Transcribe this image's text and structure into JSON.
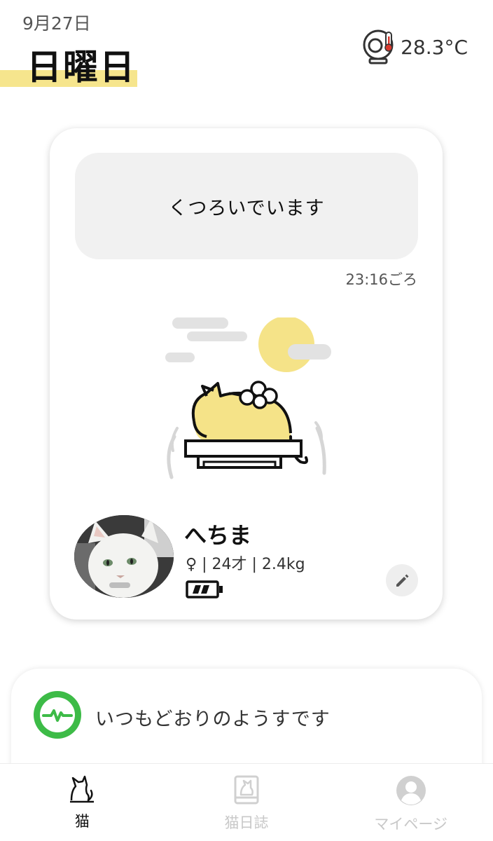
{
  "header": {
    "date": "9月27日",
    "weekday": "日曜日",
    "temperature": "28.3°C",
    "temperature_icon": "room-thermometer-icon"
  },
  "status_card": {
    "status_message": "くつろいでいます",
    "time": "23:16ごろ",
    "illustration_icon": "cat-sleeping-on-bed-icon"
  },
  "cat": {
    "name": "へちま",
    "info": "♀ | 24才 | 2.4kg",
    "battery_icon": "battery-icon",
    "edit_icon": "pencil-icon"
  },
  "health": {
    "message": "いつもどおりのようすです",
    "icon": "heartbeat-icon",
    "accent": "#3dbb47"
  },
  "bottom_nav": {
    "items": [
      {
        "label": "猫",
        "icon": "cat-icon"
      },
      {
        "label": "猫日誌",
        "icon": "diary-icon"
      },
      {
        "label": "マイページ",
        "icon": "user-icon"
      }
    ]
  },
  "colors": {
    "accent_yellow": "#f6e58d",
    "illustration_yellow": "#f5e388",
    "inactive": "#c8c8c8"
  }
}
